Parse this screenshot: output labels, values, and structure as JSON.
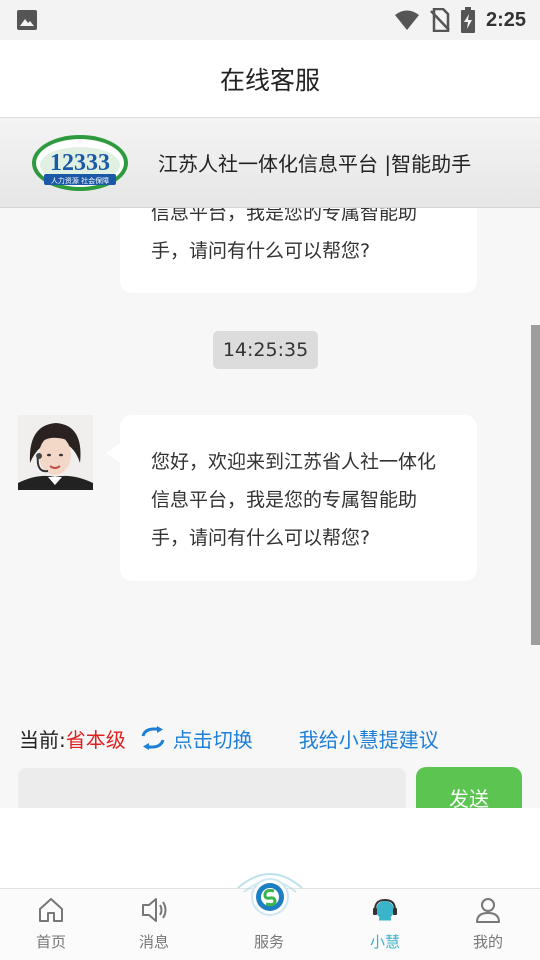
{
  "status_bar": {
    "time": "2:25"
  },
  "header": {
    "title": "在线客服"
  },
  "brand": {
    "logo_text": "12333",
    "logo_sub": "人力资源 社会保障",
    "name": "江苏人社一体化信息平台 |智能助手"
  },
  "chat": {
    "messages": [
      {
        "sender": "agent",
        "lines": [
          "信息平台，我是您的专属智能助",
          "手，请问有什么可以帮您?"
        ]
      },
      {
        "sender": "agent",
        "time": "14:25:35",
        "lines": [
          "您好，欢迎来到江苏省人社一体化",
          "信息平台，我是您的专属智能助",
          "手，请问有什么可以帮您?"
        ]
      }
    ]
  },
  "controls": {
    "current_label": "当前:",
    "current_level": "省本级",
    "switch_label": "点击切换",
    "suggest_label": "我给小慧提建议"
  },
  "composer": {
    "placeholder": "",
    "send_label": "发送"
  },
  "tabs": [
    {
      "label": "首页",
      "icon": "home-icon"
    },
    {
      "label": "消息",
      "icon": "speaker-icon"
    },
    {
      "label": "服务",
      "icon": "service-logo-icon"
    },
    {
      "label": "小慧",
      "icon": "assistant-icon",
      "active": true
    },
    {
      "label": "我的",
      "icon": "person-icon"
    }
  ],
  "colors": {
    "accent": "#5cc552",
    "link": "#1e7fd6",
    "level": "#e02020",
    "active_tab": "#3ab4c8"
  }
}
